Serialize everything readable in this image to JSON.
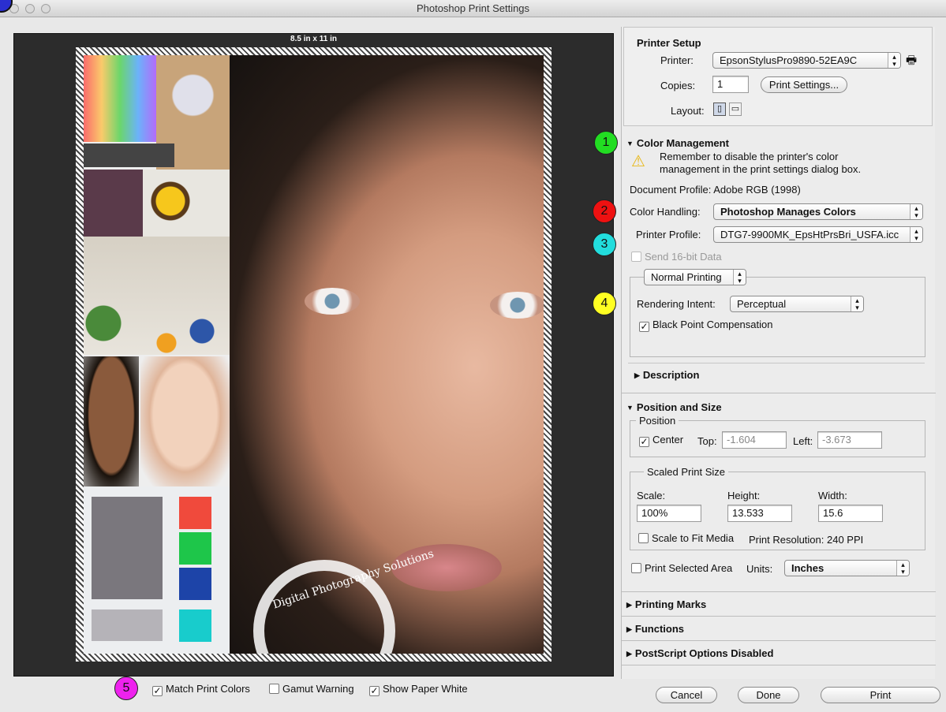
{
  "window": {
    "title": "Photoshop Print Settings"
  },
  "preview": {
    "paper_size_label": "8.5 in x 11 in",
    "logo_text": "Digital Photography Solutions"
  },
  "printer_setup": {
    "heading": "Printer Setup",
    "printer_label": "Printer:",
    "printer_value": "EpsonStylusPro9890-52EA9C",
    "copies_label": "Copies:",
    "copies_value": "1",
    "print_settings_button": "Print Settings...",
    "layout_label": "Layout:"
  },
  "color_management": {
    "heading": "Color Management",
    "warning": "Remember to disable the printer's color management in the print settings dialog box.",
    "document_profile": "Document Profile: Adobe RGB (1998)",
    "color_handling_label": "Color Handling:",
    "color_handling_value": "Photoshop Manages Colors",
    "printer_profile_label": "Printer Profile:",
    "printer_profile_value": "DTG7-9900MK_EpsHtPrsBri_USFA.icc",
    "send16_label": "Send 16-bit Data",
    "printing_mode_value": "Normal Printing",
    "rendering_intent_label": "Rendering Intent:",
    "rendering_intent_value": "Perceptual",
    "bpc_label": "Black Point Compensation",
    "bpc_checked": true,
    "description_heading": "Description"
  },
  "position_size": {
    "heading": "Position and Size",
    "position_group": "Position",
    "center_label": "Center",
    "center_checked": true,
    "top_label": "Top:",
    "top_value": "-1.604",
    "left_label": "Left:",
    "left_value": "-3.673",
    "scaled_group": "Scaled Print Size",
    "scale_label": "Scale:",
    "scale_value": "100%",
    "height_label": "Height:",
    "height_value": "13.533",
    "width_label": "Width:",
    "width_value": "15.6",
    "scale_fit_label": "Scale to Fit Media",
    "print_resolution": "Print Resolution: 240 PPI",
    "print_selected_label": "Print Selected Area",
    "units_label": "Units:",
    "units_value": "Inches"
  },
  "collapsed_sections": {
    "printing_marks": "Printing Marks",
    "functions": "Functions",
    "postscript": "PostScript Options Disabled"
  },
  "bottom_options": {
    "match_print_colors": "Match Print Colors",
    "gamut_warning": "Gamut Warning",
    "show_paper_white": "Show Paper White"
  },
  "buttons": {
    "cancel": "Cancel",
    "done": "Done",
    "print": "Print"
  },
  "annotations": [
    {
      "label": "1",
      "color": "#22dd22"
    },
    {
      "label": "2",
      "color": "#ee1111"
    },
    {
      "label": "3",
      "color": "#22dddd"
    },
    {
      "label": "4",
      "color": "#ffff22"
    },
    {
      "label": "5",
      "color": "#ee22ee"
    }
  ]
}
